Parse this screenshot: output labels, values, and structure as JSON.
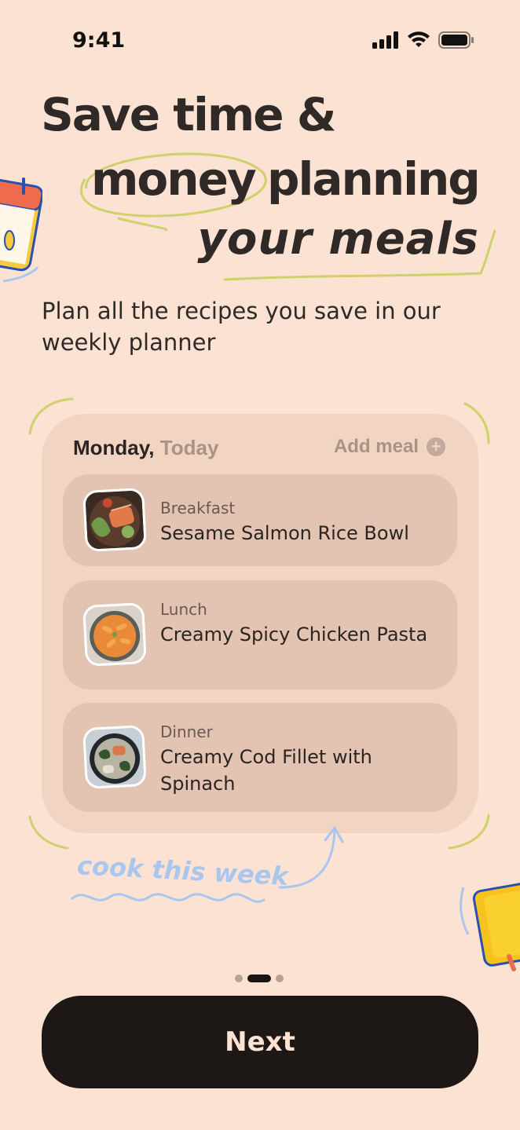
{
  "status_bar": {
    "time": "9:41"
  },
  "headline": {
    "line1": "Save time &",
    "word_money": "money",
    "word_planning": "planning",
    "line3": "your meals"
  },
  "subtitle": "Plan all the recipes you save in our weekly planner",
  "planner": {
    "day_name": "Monday,",
    "day_relative": "Today",
    "add_meal_label": "Add meal",
    "meals": [
      {
        "type": "Breakfast",
        "name": "Sesame Salmon Rice Bowl"
      },
      {
        "type": "Lunch",
        "name": "Creamy Spicy Chicken Pasta"
      },
      {
        "type": "Dinner",
        "name": "Creamy Cod Fillet with Spinach"
      }
    ]
  },
  "annotation": "cook this week",
  "pagination": {
    "total": 3,
    "active": 2
  },
  "next_label": "Next",
  "colors": {
    "background": "#fce2d3",
    "card": "#f2d4c3",
    "meal_card": "#e3c3b1",
    "button": "#1d1816",
    "accent_green": "#cfd16a",
    "accent_blue": "#a9c6ee"
  }
}
